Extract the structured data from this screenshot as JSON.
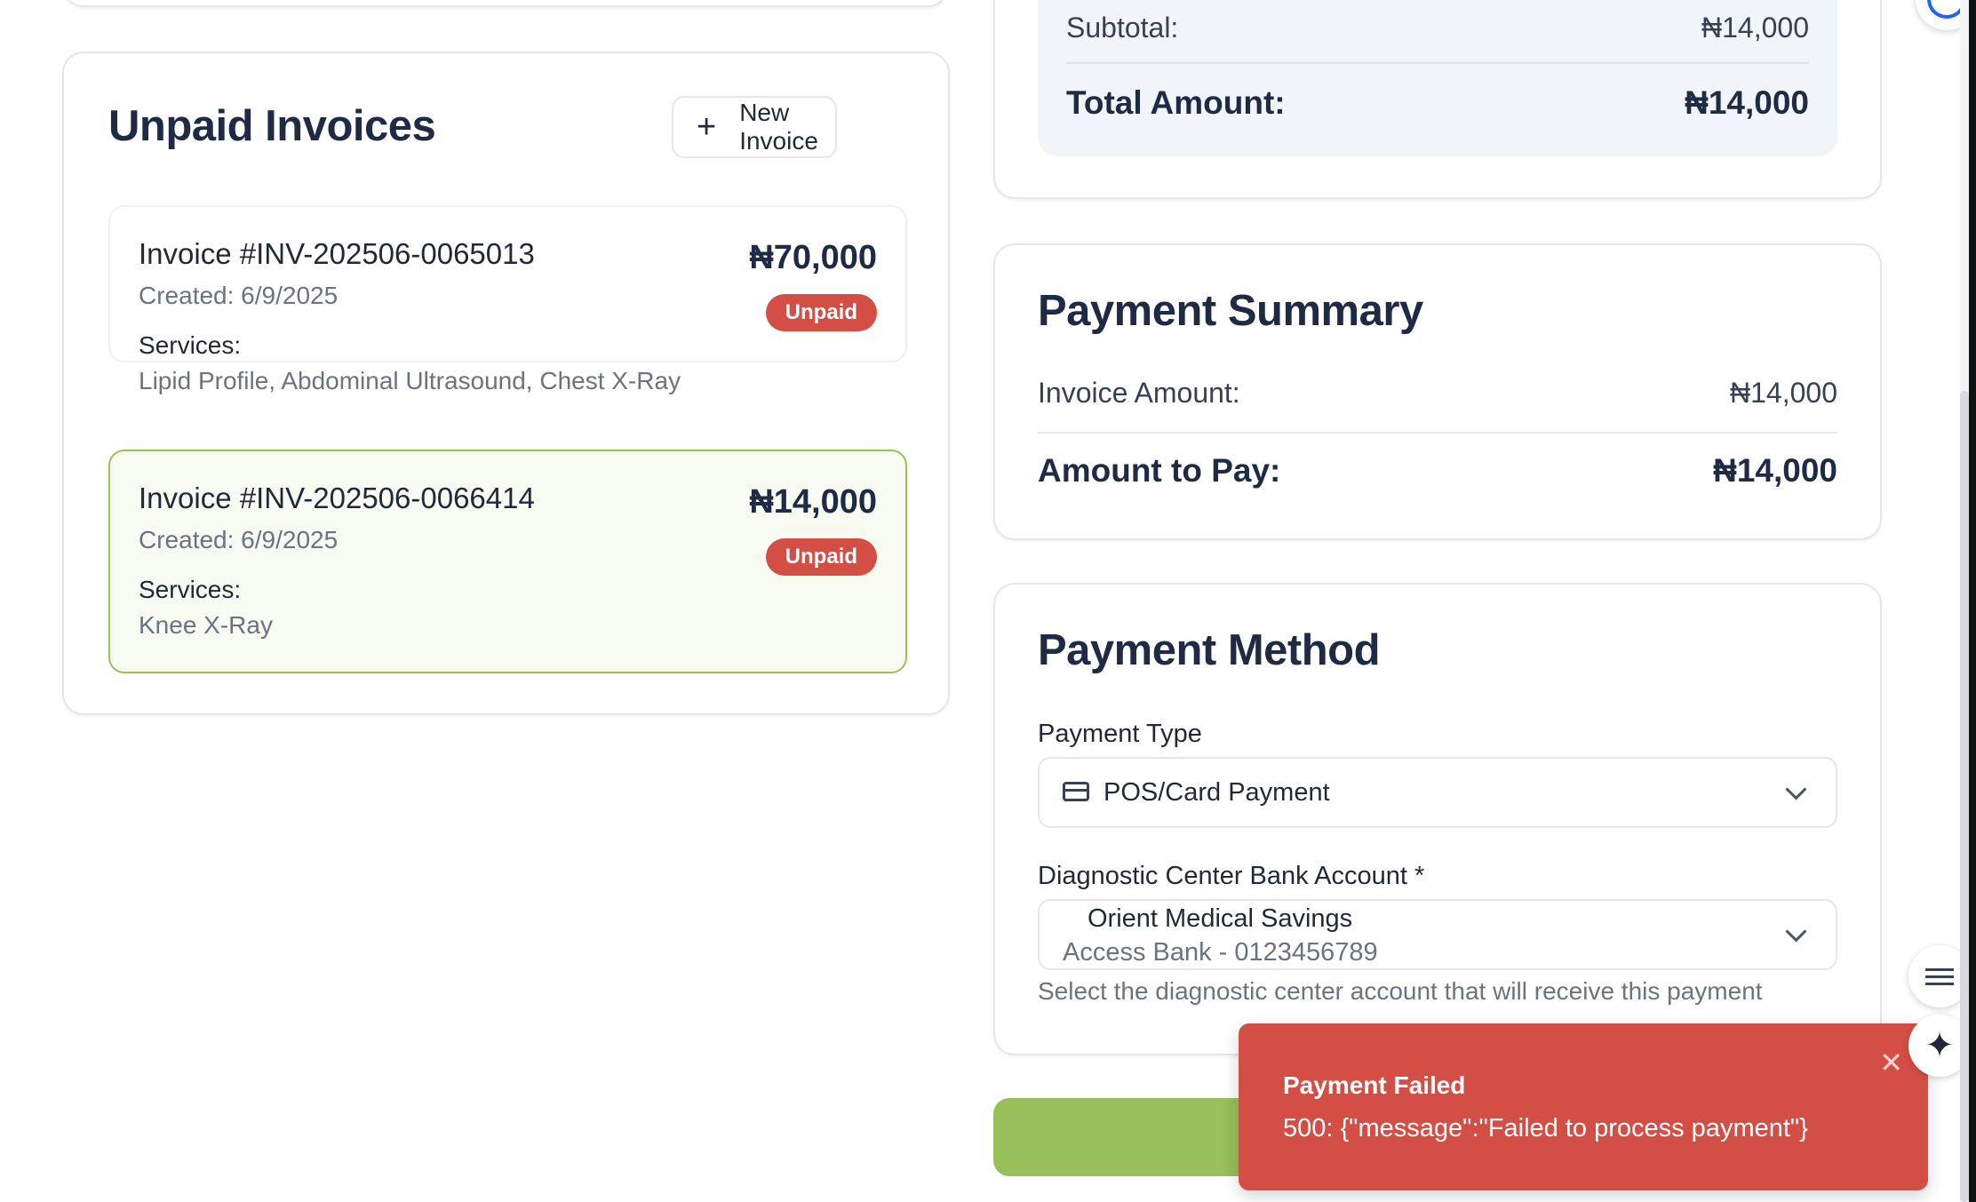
{
  "unpaid_invoices": {
    "title": "Unpaid Invoices",
    "new_invoice_label": "New Invoice",
    "items": [
      {
        "id": "Invoice #INV-202506-0065013",
        "created": "Created: 6/9/2025",
        "services_label": "Services:",
        "services": "Lipid Profile, Abdominal Ultrasound, Chest X-Ray",
        "amount": "₦70,000",
        "status": "Unpaid",
        "selected": false
      },
      {
        "id": "Invoice #INV-202506-0066414",
        "created": "Created: 6/9/2025",
        "services_label": "Services:",
        "services": "Knee X-Ray",
        "amount": "₦14,000",
        "status": "Unpaid",
        "selected": true
      }
    ]
  },
  "totals": {
    "subtotal_label": "Subtotal:",
    "subtotal_value": "₦14,000",
    "total_label": "Total Amount:",
    "total_value": "₦14,000"
  },
  "payment_summary": {
    "title": "Payment Summary",
    "invoice_amount_label": "Invoice Amount:",
    "invoice_amount_value": "₦14,000",
    "amount_to_pay_label": "Amount to Pay:",
    "amount_to_pay_value": "₦14,000"
  },
  "payment_method": {
    "title": "Payment Method",
    "payment_type_label": "Payment Type",
    "payment_type_value": "POS/Card Payment",
    "payment_type_icon": "credit-card-icon",
    "bank_account_label": "Diagnostic Center Bank Account *",
    "bank_account_name": "Orient Medical Savings",
    "bank_account_detail": "Access Bank - 0123456789",
    "bank_account_help": "Select the diagnostic center account that will receive this payment"
  },
  "toast": {
    "title": "Payment Failed",
    "message": "500: {\"message\":\"Failed to process payment\"}",
    "close_icon": "close-icon"
  },
  "colors": {
    "unpaid_badge": "#d34e45",
    "toast_bg": "#d34e45",
    "submit_button": "#97bf5a",
    "selected_border": "#9bc05a"
  }
}
